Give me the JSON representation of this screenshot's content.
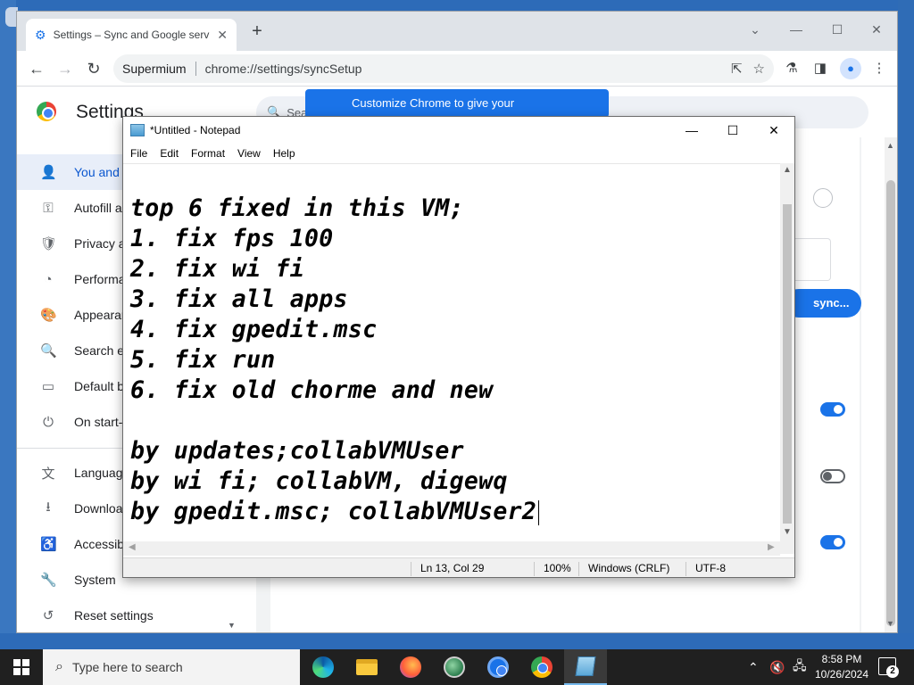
{
  "browser": {
    "tab_title": "Settings – Sync and Google serv",
    "newtab_symbol": "+",
    "site_label": "Supermium",
    "url": "chrome://settings/syncSetup"
  },
  "settings": {
    "title": "Settings",
    "search_placeholder": "Sear",
    "bubble_text": "Customize Chrome to give your",
    "sync_button": "sync...",
    "sidebar": [
      {
        "label": "You and",
        "icon": "person-icon",
        "glyph": "👤"
      },
      {
        "label": "Autofill a",
        "icon": "key-icon",
        "glyph": "⚿"
      },
      {
        "label": "Privacy a",
        "icon": "shield-icon",
        "glyph": "🛡"
      },
      {
        "label": "Performa",
        "icon": "speedometer-icon",
        "glyph": "◔"
      },
      {
        "label": "Appearan",
        "icon": "palette-icon",
        "glyph": "🎨"
      },
      {
        "label": "Search en",
        "icon": "search-icon",
        "glyph": "🔍"
      },
      {
        "label": "Default b",
        "icon": "browser-icon",
        "glyph": "▭"
      },
      {
        "label": "On start-",
        "icon": "power-icon",
        "glyph": "⏻"
      },
      {
        "label": "Languag",
        "icon": "translate-icon",
        "glyph": "文"
      },
      {
        "label": "Downloa",
        "icon": "download-icon",
        "glyph": "⭳"
      },
      {
        "label": "Accessib",
        "icon": "accessibility-icon",
        "glyph": "♿"
      },
      {
        "label": "System",
        "icon": "wrench-icon",
        "glyph": "🔧"
      },
      {
        "label": "Reset settings",
        "icon": "reset-icon",
        "glyph": "↺"
      }
    ]
  },
  "notepad": {
    "title": "*Untitled - Notepad",
    "menu": [
      "File",
      "Edit",
      "Format",
      "View",
      "Help"
    ],
    "text": "top 6 fixed in this VM;\n1. fix fps 100\n2. fix wi fi\n3. fix all apps\n4. fix gpedit.msc\n5. fix run\n6. fix old chorme and new\n\nby updates;collabVMUser\nby wi fi; collabVM, digewq\nby gpedit.msc; collabVMUser2",
    "status": {
      "position": "Ln 13, Col 29",
      "zoom": "100%",
      "line_ending": "Windows (CRLF)",
      "encoding": "UTF-8"
    }
  },
  "taskbar": {
    "search_placeholder": "Type here to search",
    "time": "8:58 PM",
    "date": "10/26/2024",
    "notification_count": "2"
  }
}
